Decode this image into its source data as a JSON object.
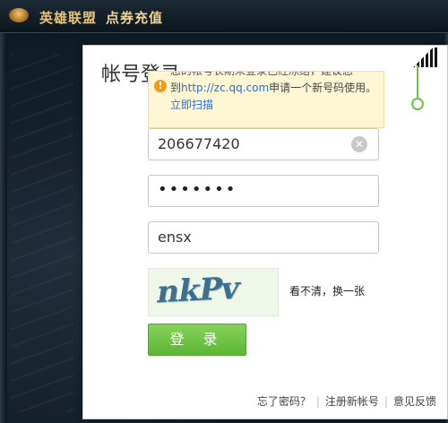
{
  "window": {
    "title": "英雄联盟",
    "subtitle": "点券充值"
  },
  "dialog": {
    "title": "帐号登录",
    "notice": {
      "partial_line": "您的帐号长期未登录已经冻结，建议您",
      "line_prefix": "到",
      "link_text": "http://zc.qq.com",
      "line_suffix": "申请一个新号码使用。",
      "action_text": "立即扫描"
    },
    "account_value": "206677420",
    "password_mask": "•••••••",
    "captcha_input_value": "ensx",
    "captcha_image_text": "nkPv",
    "captcha_refresh_label": "看不清，换一张",
    "login_button_label": "登 录",
    "footer": {
      "forgot_password": "忘了密码？",
      "register": "注册新帐号",
      "feedback": "意见反馈"
    }
  },
  "colors": {
    "accent_green": "#5cb634",
    "link_blue": "#2a6fd6",
    "notice_bg": "#fff6d6",
    "title_gold": "#e9c27a"
  }
}
